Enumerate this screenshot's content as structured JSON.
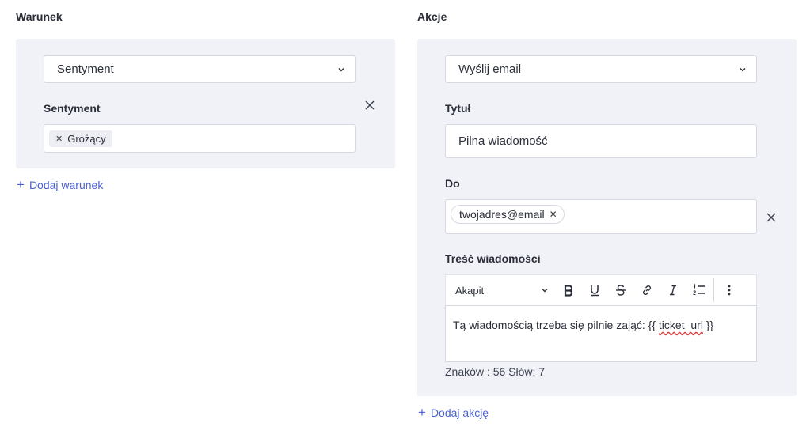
{
  "condition": {
    "title": "Warunek",
    "select_value": "Sentyment",
    "field_label": "Sentyment",
    "tags": [
      {
        "label": "Grożący"
      }
    ],
    "add_label": "Dodaj warunek"
  },
  "actions": {
    "title": "Akcje",
    "select_value": "Wyślij email",
    "subject_label": "Tytuł",
    "subject_value": "Pilna wiadomość",
    "to_label": "Do",
    "to_chips": [
      {
        "label": "twojadres@email"
      }
    ],
    "body_label": "Treść wiadomości",
    "toolbar": {
      "paragraph": "Akapit",
      "buttons": [
        "bold-icon",
        "underline-icon",
        "strikethrough-icon",
        "link-icon",
        "italic-icon",
        "numbered-list-icon",
        "more-vertical-icon"
      ]
    },
    "body_text_prefix": "Tą wiadomością trzeba się pilnie zająć: {{ ",
    "body_text_var": "ticket_url",
    "body_text_suffix": " }}",
    "counter": "Znaków : 56 Słów: 7",
    "add_label": "Dodaj akcję"
  },
  "colors": {
    "accent": "#4b61d1",
    "panel_bg": "#f1f2f7",
    "border": "#d6d9e2"
  }
}
